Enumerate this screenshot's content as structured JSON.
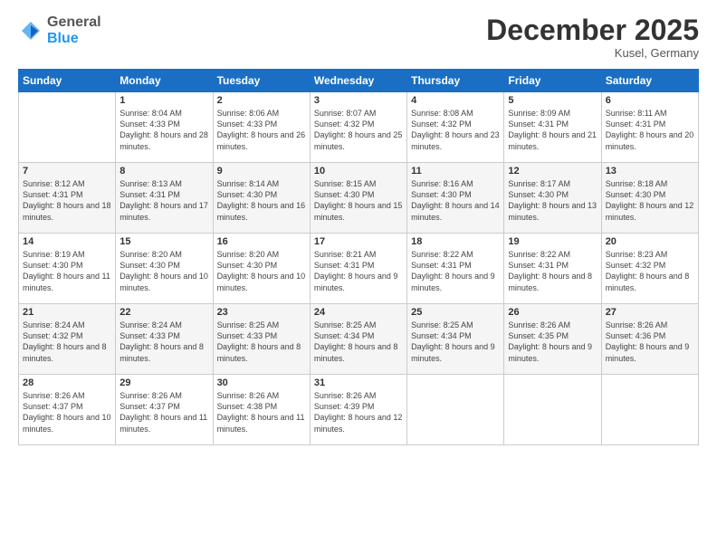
{
  "header": {
    "logo_general": "General",
    "logo_blue": "Blue",
    "month_title": "December 2025",
    "location": "Kusel, Germany"
  },
  "weekdays": [
    "Sunday",
    "Monday",
    "Tuesday",
    "Wednesday",
    "Thursday",
    "Friday",
    "Saturday"
  ],
  "weeks": [
    [
      {
        "day": "",
        "sunrise": "",
        "sunset": "",
        "daylight": ""
      },
      {
        "day": "1",
        "sunrise": "Sunrise: 8:04 AM",
        "sunset": "Sunset: 4:33 PM",
        "daylight": "Daylight: 8 hours and 28 minutes."
      },
      {
        "day": "2",
        "sunrise": "Sunrise: 8:06 AM",
        "sunset": "Sunset: 4:33 PM",
        "daylight": "Daylight: 8 hours and 26 minutes."
      },
      {
        "day": "3",
        "sunrise": "Sunrise: 8:07 AM",
        "sunset": "Sunset: 4:32 PM",
        "daylight": "Daylight: 8 hours and 25 minutes."
      },
      {
        "day": "4",
        "sunrise": "Sunrise: 8:08 AM",
        "sunset": "Sunset: 4:32 PM",
        "daylight": "Daylight: 8 hours and 23 minutes."
      },
      {
        "day": "5",
        "sunrise": "Sunrise: 8:09 AM",
        "sunset": "Sunset: 4:31 PM",
        "daylight": "Daylight: 8 hours and 21 minutes."
      },
      {
        "day": "6",
        "sunrise": "Sunrise: 8:11 AM",
        "sunset": "Sunset: 4:31 PM",
        "daylight": "Daylight: 8 hours and 20 minutes."
      }
    ],
    [
      {
        "day": "7",
        "sunrise": "Sunrise: 8:12 AM",
        "sunset": "Sunset: 4:31 PM",
        "daylight": "Daylight: 8 hours and 18 minutes."
      },
      {
        "day": "8",
        "sunrise": "Sunrise: 8:13 AM",
        "sunset": "Sunset: 4:31 PM",
        "daylight": "Daylight: 8 hours and 17 minutes."
      },
      {
        "day": "9",
        "sunrise": "Sunrise: 8:14 AM",
        "sunset": "Sunset: 4:30 PM",
        "daylight": "Daylight: 8 hours and 16 minutes."
      },
      {
        "day": "10",
        "sunrise": "Sunrise: 8:15 AM",
        "sunset": "Sunset: 4:30 PM",
        "daylight": "Daylight: 8 hours and 15 minutes."
      },
      {
        "day": "11",
        "sunrise": "Sunrise: 8:16 AM",
        "sunset": "Sunset: 4:30 PM",
        "daylight": "Daylight: 8 hours and 14 minutes."
      },
      {
        "day": "12",
        "sunrise": "Sunrise: 8:17 AM",
        "sunset": "Sunset: 4:30 PM",
        "daylight": "Daylight: 8 hours and 13 minutes."
      },
      {
        "day": "13",
        "sunrise": "Sunrise: 8:18 AM",
        "sunset": "Sunset: 4:30 PM",
        "daylight": "Daylight: 8 hours and 12 minutes."
      }
    ],
    [
      {
        "day": "14",
        "sunrise": "Sunrise: 8:19 AM",
        "sunset": "Sunset: 4:30 PM",
        "daylight": "Daylight: 8 hours and 11 minutes."
      },
      {
        "day": "15",
        "sunrise": "Sunrise: 8:20 AM",
        "sunset": "Sunset: 4:30 PM",
        "daylight": "Daylight: 8 hours and 10 minutes."
      },
      {
        "day": "16",
        "sunrise": "Sunrise: 8:20 AM",
        "sunset": "Sunset: 4:30 PM",
        "daylight": "Daylight: 8 hours and 10 minutes."
      },
      {
        "day": "17",
        "sunrise": "Sunrise: 8:21 AM",
        "sunset": "Sunset: 4:31 PM",
        "daylight": "Daylight: 8 hours and 9 minutes."
      },
      {
        "day": "18",
        "sunrise": "Sunrise: 8:22 AM",
        "sunset": "Sunset: 4:31 PM",
        "daylight": "Daylight: 8 hours and 9 minutes."
      },
      {
        "day": "19",
        "sunrise": "Sunrise: 8:22 AM",
        "sunset": "Sunset: 4:31 PM",
        "daylight": "Daylight: 8 hours and 8 minutes."
      },
      {
        "day": "20",
        "sunrise": "Sunrise: 8:23 AM",
        "sunset": "Sunset: 4:32 PM",
        "daylight": "Daylight: 8 hours and 8 minutes."
      }
    ],
    [
      {
        "day": "21",
        "sunrise": "Sunrise: 8:24 AM",
        "sunset": "Sunset: 4:32 PM",
        "daylight": "Daylight: 8 hours and 8 minutes."
      },
      {
        "day": "22",
        "sunrise": "Sunrise: 8:24 AM",
        "sunset": "Sunset: 4:33 PM",
        "daylight": "Daylight: 8 hours and 8 minutes."
      },
      {
        "day": "23",
        "sunrise": "Sunrise: 8:25 AM",
        "sunset": "Sunset: 4:33 PM",
        "daylight": "Daylight: 8 hours and 8 minutes."
      },
      {
        "day": "24",
        "sunrise": "Sunrise: 8:25 AM",
        "sunset": "Sunset: 4:34 PM",
        "daylight": "Daylight: 8 hours and 8 minutes."
      },
      {
        "day": "25",
        "sunrise": "Sunrise: 8:25 AM",
        "sunset": "Sunset: 4:34 PM",
        "daylight": "Daylight: 8 hours and 9 minutes."
      },
      {
        "day": "26",
        "sunrise": "Sunrise: 8:26 AM",
        "sunset": "Sunset: 4:35 PM",
        "daylight": "Daylight: 8 hours and 9 minutes."
      },
      {
        "day": "27",
        "sunrise": "Sunrise: 8:26 AM",
        "sunset": "Sunset: 4:36 PM",
        "daylight": "Daylight: 8 hours and 9 minutes."
      }
    ],
    [
      {
        "day": "28",
        "sunrise": "Sunrise: 8:26 AM",
        "sunset": "Sunset: 4:37 PM",
        "daylight": "Daylight: 8 hours and 10 minutes."
      },
      {
        "day": "29",
        "sunrise": "Sunrise: 8:26 AM",
        "sunset": "Sunset: 4:37 PM",
        "daylight": "Daylight: 8 hours and 11 minutes."
      },
      {
        "day": "30",
        "sunrise": "Sunrise: 8:26 AM",
        "sunset": "Sunset: 4:38 PM",
        "daylight": "Daylight: 8 hours and 11 minutes."
      },
      {
        "day": "31",
        "sunrise": "Sunrise: 8:26 AM",
        "sunset": "Sunset: 4:39 PM",
        "daylight": "Daylight: 8 hours and 12 minutes."
      },
      {
        "day": "",
        "sunrise": "",
        "sunset": "",
        "daylight": ""
      },
      {
        "day": "",
        "sunrise": "",
        "sunset": "",
        "daylight": ""
      },
      {
        "day": "",
        "sunrise": "",
        "sunset": "",
        "daylight": ""
      }
    ]
  ]
}
